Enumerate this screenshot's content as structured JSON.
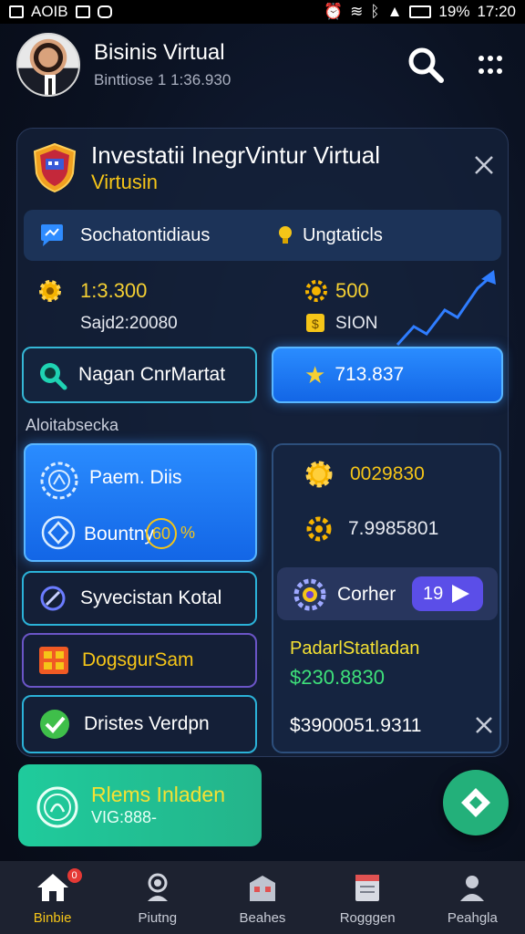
{
  "status_bar": {
    "left_text": "AOIB",
    "battery": "19%",
    "time": "17:20"
  },
  "header": {
    "title": "Bisinis Virtual",
    "subtitle": "Binttiose 1 1:36.930"
  },
  "panel": {
    "title": "Investatii InegrVintur Virtual",
    "subtitle": "Virtusin",
    "info_strip": {
      "left_label": "Sochatontidiaus",
      "right_label": "Ungtaticls"
    },
    "stats": {
      "left_value": "1:3.300",
      "left_sub": "Sajd2:20080",
      "right_value": "500",
      "right_sub": "SION"
    },
    "buttons": {
      "magan": "Nagan CnrMartat",
      "star_value": "713.837"
    },
    "section_label": "Aloitabsecka",
    "left_cards": {
      "paem": "Paem. Diis",
      "bountry": "Bountny",
      "bountry_pct": "60",
      "pct_sign": "%",
      "syvecistan": "Syvecistan Kotal",
      "dogsgur": "DogsgurSam",
      "dristes": "Dristes Verdpn"
    },
    "right_card": {
      "value1": "0029830",
      "value2": "7.9985801",
      "coher_label": "Corher",
      "play_number": "19",
      "padar_label": "PadarlStatladan",
      "padar_value": "$230.8830",
      "bottom_value": "$3900051.9311"
    },
    "green_card": {
      "title": "Rlems Inladen",
      "subtitle": "VIG:888-"
    }
  },
  "colors": {
    "accent_yellow": "#f5c518",
    "accent_blue": "#1e7bff",
    "accent_green": "#23b07a",
    "panel_bg": "#14213a"
  },
  "bottom_nav": [
    {
      "label": "Binbie",
      "icon": "home-icon",
      "active": true,
      "badge": "0"
    },
    {
      "label": "Piutng",
      "icon": "person-icon",
      "active": false
    },
    {
      "label": "Beahes",
      "icon": "building-icon",
      "active": false
    },
    {
      "label": "Rogggen",
      "icon": "document-icon",
      "active": false
    },
    {
      "label": "Peahgla",
      "icon": "user-icon",
      "active": false
    }
  ]
}
